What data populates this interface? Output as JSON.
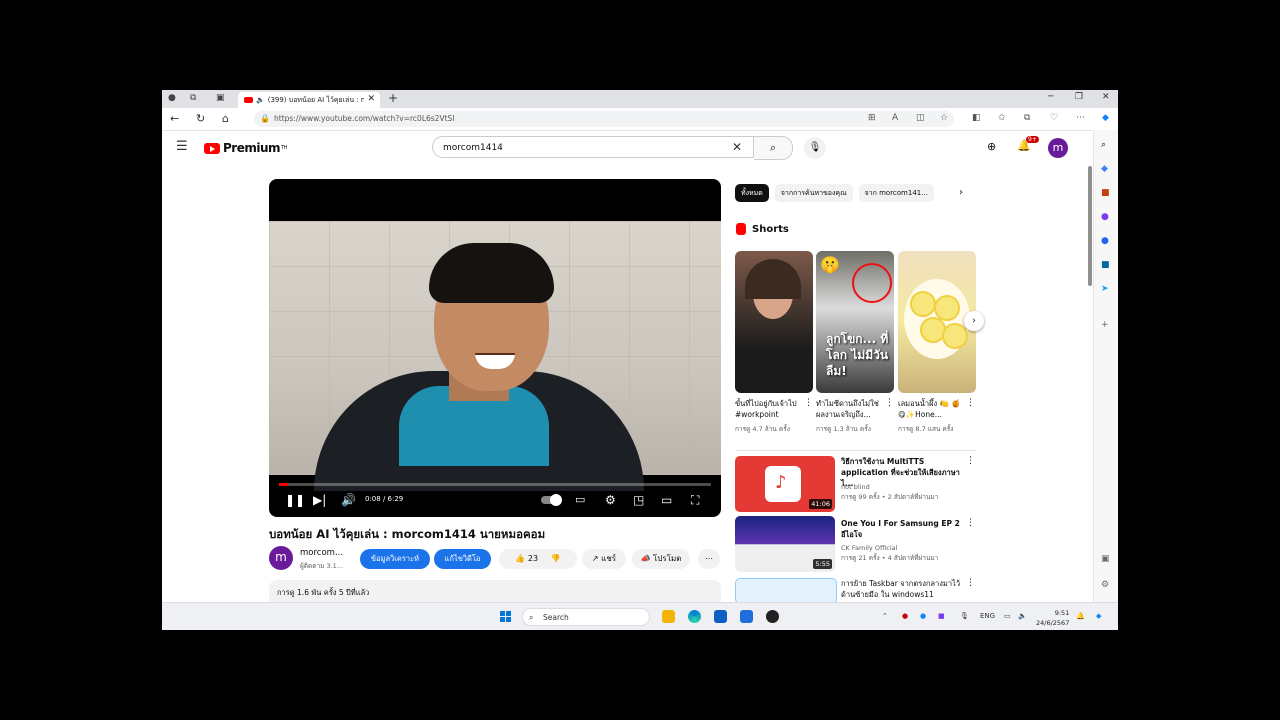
{
  "browser": {
    "tab_title": "(399) บอทน้อย AI ไว้คุยเล่น : mo...",
    "url": "https://www.youtube.com/watch?v=rc0L6s2VtSI"
  },
  "header": {
    "logo_text": "Premium",
    "logo_sup": "TH",
    "search_query": "morcom1414",
    "notif_count": "9+",
    "avatar_letter": "m"
  },
  "player": {
    "time": "0:08 / 6:29",
    "progress": 0.02
  },
  "video": {
    "title": "บอทน้อย AI ไว้คุยเล่น : morcom1414 นายหมอคอม",
    "channel_letter": "m",
    "channel_name": "morcom...",
    "channel_subs": "ผู้ติดตาม 3.1...",
    "btn_analyze": "ข้อมูลวิเคราะห์",
    "btn_edit": "แก้ไขวิดีโอ",
    "likes": "23",
    "share": "แชร์",
    "promote": "โปรโมต",
    "views_date": "การดู 1.6 พัน ครั้ง  5 ปีที่แล้ว"
  },
  "chips": [
    "ทั้งหมด",
    "จากการค้นหาของคุณ",
    "จาก morcom141..."
  ],
  "shorts": {
    "heading": "Shorts",
    "overlay_text": "ลูกโขก... ที่โลก ไม่มีวันลืม!",
    "items": [
      {
        "title": "ขั้นที่ไปอยู่กับเจ้าไป #workpoint",
        "views": "การดู 4.7 ล้าน ครั้ง"
      },
      {
        "title": "ทำไมซีดานถึงไม่ใช่ผลงานเจริญถึง...",
        "views": "การดู 1.3 ล้าน ครั้ง"
      },
      {
        "title": "เลมอนน้ำผึ้ง 🍋 🍯😋✨Hone...",
        "views": "การดู 8.7 แสน ครั้ง"
      }
    ]
  },
  "recommendations": [
    {
      "title": "วิธีการใช้งาน MultiTTS application ที่จะช่วยให้เสียงภาษาไ...",
      "channel": "not blind",
      "meta": "การดู 99 ครั้ง • 2 สัปดาห์ที่ผ่านมา",
      "duration": "41:06"
    },
    {
      "title": "One You I For Samsung EP 2 อีไอโจ",
      "channel": "CK Family Official",
      "meta": "การดู 21 ครั้ง • 4 สัปดาห์ที่ผ่านมา",
      "duration": "5:55"
    },
    {
      "title": "การย้าย Taskbar จากตรงกลางมาไว้ด้านซ้ายมือ ใน windows11",
      "channel": "",
      "meta": "",
      "duration": ""
    }
  ],
  "taskbar": {
    "search_placeholder": "Search",
    "lang": "ENG",
    "time": "9:51",
    "date": "24/6/2567"
  },
  "colors": {
    "brand_red": "#ff0000",
    "accent_blue": "#1a73e8",
    "channel_purple": "#6a1b9a"
  }
}
